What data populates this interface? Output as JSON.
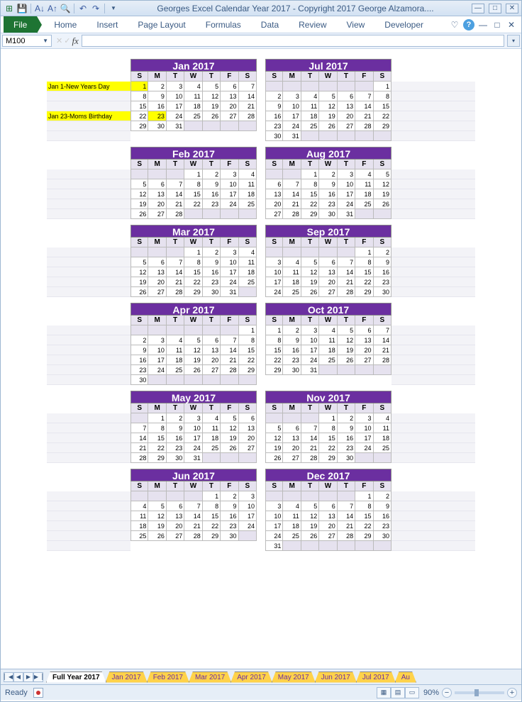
{
  "titlebar": {
    "title": "Georges Excel Calendar Year 2017  -  Copyright 2017 George Alzamora...."
  },
  "ribbon": {
    "file": "File",
    "tabs": [
      "Home",
      "Insert",
      "Page Layout",
      "Formulas",
      "Data",
      "Review",
      "View",
      "Developer"
    ]
  },
  "namebox": "M100",
  "dow": [
    "S",
    "M",
    "T",
    "W",
    "T",
    "F",
    "S"
  ],
  "months": [
    {
      "title": "Jan 2017",
      "start": 0,
      "days": 31,
      "highlights": [
        1,
        23
      ]
    },
    {
      "title": "Feb 2017",
      "start": 3,
      "days": 28,
      "highlights": []
    },
    {
      "title": "Mar 2017",
      "start": 3,
      "days": 31,
      "highlights": []
    },
    {
      "title": "Apr 2017",
      "start": 6,
      "days": 30,
      "highlights": []
    },
    {
      "title": "May 2017",
      "start": 1,
      "days": 31,
      "highlights": []
    },
    {
      "title": "Jun 2017",
      "start": 4,
      "days": 30,
      "highlights": []
    },
    {
      "title": "Jul 2017",
      "start": 6,
      "days": 31,
      "highlights": []
    },
    {
      "title": "Aug 2017",
      "start": 2,
      "days": 31,
      "highlights": []
    },
    {
      "title": "Sep 2017",
      "start": 5,
      "days": 30,
      "highlights": []
    },
    {
      "title": "Oct 2017",
      "start": 0,
      "days": 31,
      "highlights": []
    },
    {
      "title": "Nov 2017",
      "start": 3,
      "days": 30,
      "highlights": []
    },
    {
      "title": "Dec 2017",
      "start": 5,
      "days": 31,
      "highlights": []
    }
  ],
  "notes_left": [
    {
      "row": 0,
      "text": "Jan 1-New Years Day",
      "hl": true
    },
    {
      "row": 3,
      "text": "Jan 23-Moms Birthday",
      "hl": true
    }
  ],
  "sheet_tabs": [
    "Full Year 2017",
    "Jan 2017",
    "Feb 2017",
    "Mar 2017",
    "Apr 2017",
    "May 2017",
    "Jun 2017",
    "Jul 2017",
    "Au"
  ],
  "status": {
    "ready": "Ready",
    "zoom": "90%"
  }
}
